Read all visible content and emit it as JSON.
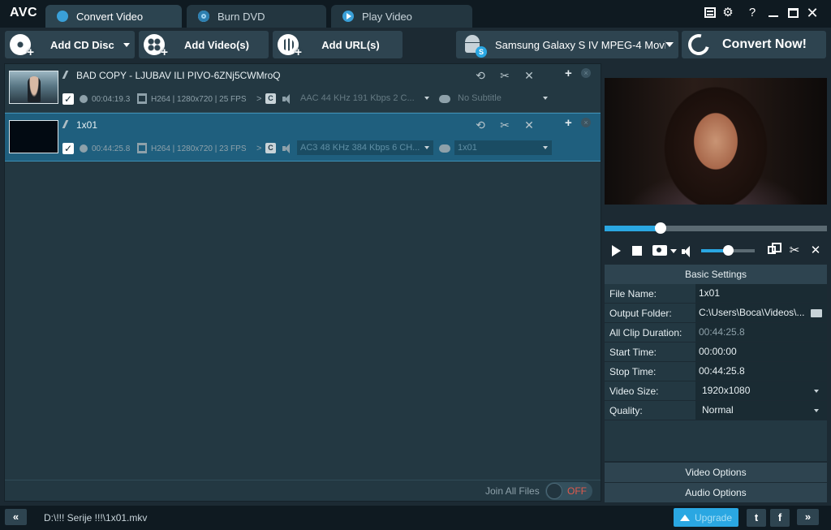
{
  "app": {
    "logo": "AVC"
  },
  "tabs": [
    {
      "label": "Convert Video",
      "active": true,
      "icon": "convert-icon"
    },
    {
      "label": "Burn DVD",
      "active": false,
      "icon": "disc-icon"
    },
    {
      "label": "Play Video",
      "active": false,
      "icon": "play-icon"
    }
  ],
  "window_controls": {
    "menu": "menu-icon",
    "settings": "gear-icon",
    "help": "?",
    "minimize": "minimize-icon",
    "maximize": "maximize-icon",
    "close": "✕"
  },
  "toolbar": {
    "add_cd_disc": "Add CD Disc",
    "add_videos": "Add Video(s)",
    "add_urls": "Add URL(s)",
    "profile": "Samsung Galaxy S IV MPEG-4 Movie (...",
    "convert_now": "Convert Now!"
  },
  "files": [
    {
      "title": "BAD COPY - LJUBAV ILI PIVO-6ZNj5CWMroQ",
      "checked": true,
      "duration": "00:04:19.3",
      "video_info": "H264 | 1280x720 | 25 FPS",
      "audio": "AAC 44 KHz 191 Kbps 2 C...",
      "subtitle": "No Subtitle",
      "selected": false
    },
    {
      "title": "1x01",
      "checked": true,
      "duration": "00:44:25.8",
      "video_info": "H264 | 1280x720 | 23 FPS",
      "audio": "AC3 48 KHz 384 Kbps 6 CH...",
      "subtitle": "1x01",
      "selected": true
    }
  ],
  "row_icons": {
    "check": "✓",
    "arrow": ">",
    "codec_badge": "C",
    "sync": "⟲",
    "cut": "✂",
    "effects": "✕",
    "add": "+",
    "remove": "×"
  },
  "join": {
    "label": "Join All Files",
    "state": "OFF"
  },
  "player": {
    "progress": 0.25,
    "volume": 0.5
  },
  "player_icons": {
    "window": "window-icon",
    "cut": "✂",
    "effects": "✕"
  },
  "basic_settings": {
    "title": "Basic Settings",
    "rows": [
      {
        "label": "File Name:",
        "value": "1x01"
      },
      {
        "label": "Output Folder:",
        "value": "C:\\Users\\Boca\\Videos\\..."
      },
      {
        "label": "All Clip Duration:",
        "value": "00:44:25.8"
      },
      {
        "label": "Start Time:",
        "value": "00:00:00"
      },
      {
        "label": "Stop Time:",
        "value": "00:44:25.8"
      },
      {
        "label": "Video Size:",
        "value": "1920x1080"
      },
      {
        "label": "Quality:",
        "value": "Normal"
      }
    ]
  },
  "options": {
    "video": "Video Options",
    "audio": "Audio Options"
  },
  "statusbar": {
    "collapse": "«",
    "path": "D:\\!!! Serije !!!\\1x01.mkv",
    "upgrade": "Upgrade",
    "twitter": "t",
    "facebook": "f",
    "expand": "»"
  },
  "colors": {
    "accent": "#2aa7e2",
    "selected_row": "#1f5f7e",
    "toggle_off": "#e05a4d"
  }
}
